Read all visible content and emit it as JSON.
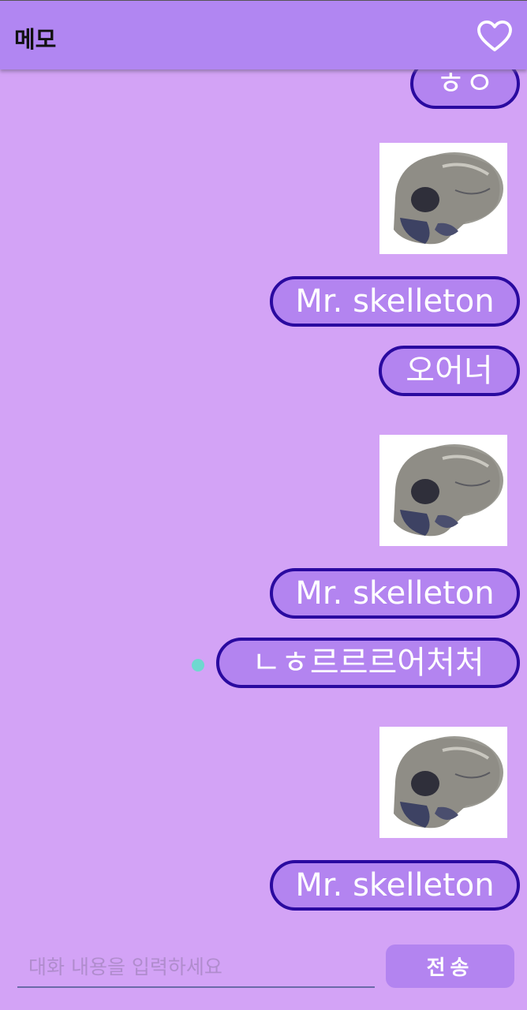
{
  "header": {
    "title": "메모",
    "favorite_icon": "heart-outline-icon"
  },
  "messages": [
    {
      "type": "text",
      "text": "ㅎㅇ"
    },
    {
      "type": "image",
      "alt": "skull"
    },
    {
      "type": "text",
      "text": "Mr. skelleton"
    },
    {
      "type": "text",
      "text": "오어너"
    },
    {
      "type": "image",
      "alt": "skull"
    },
    {
      "type": "text",
      "text": "Mr. skelleton"
    },
    {
      "type": "text",
      "text": "ㄴㅎ르르르어처처"
    },
    {
      "type": "image",
      "alt": "skull"
    },
    {
      "type": "text",
      "text": "Mr. skelleton"
    }
  ],
  "composer": {
    "placeholder": "대화 내용을 입력하세요",
    "value": "",
    "send_label": "전송"
  },
  "colors": {
    "background": "#d3a3f6",
    "header": "#b186f2",
    "bubble": "#b384f0",
    "bubble_border": "#2a0aa0",
    "indicator": "#6fd8cf"
  }
}
